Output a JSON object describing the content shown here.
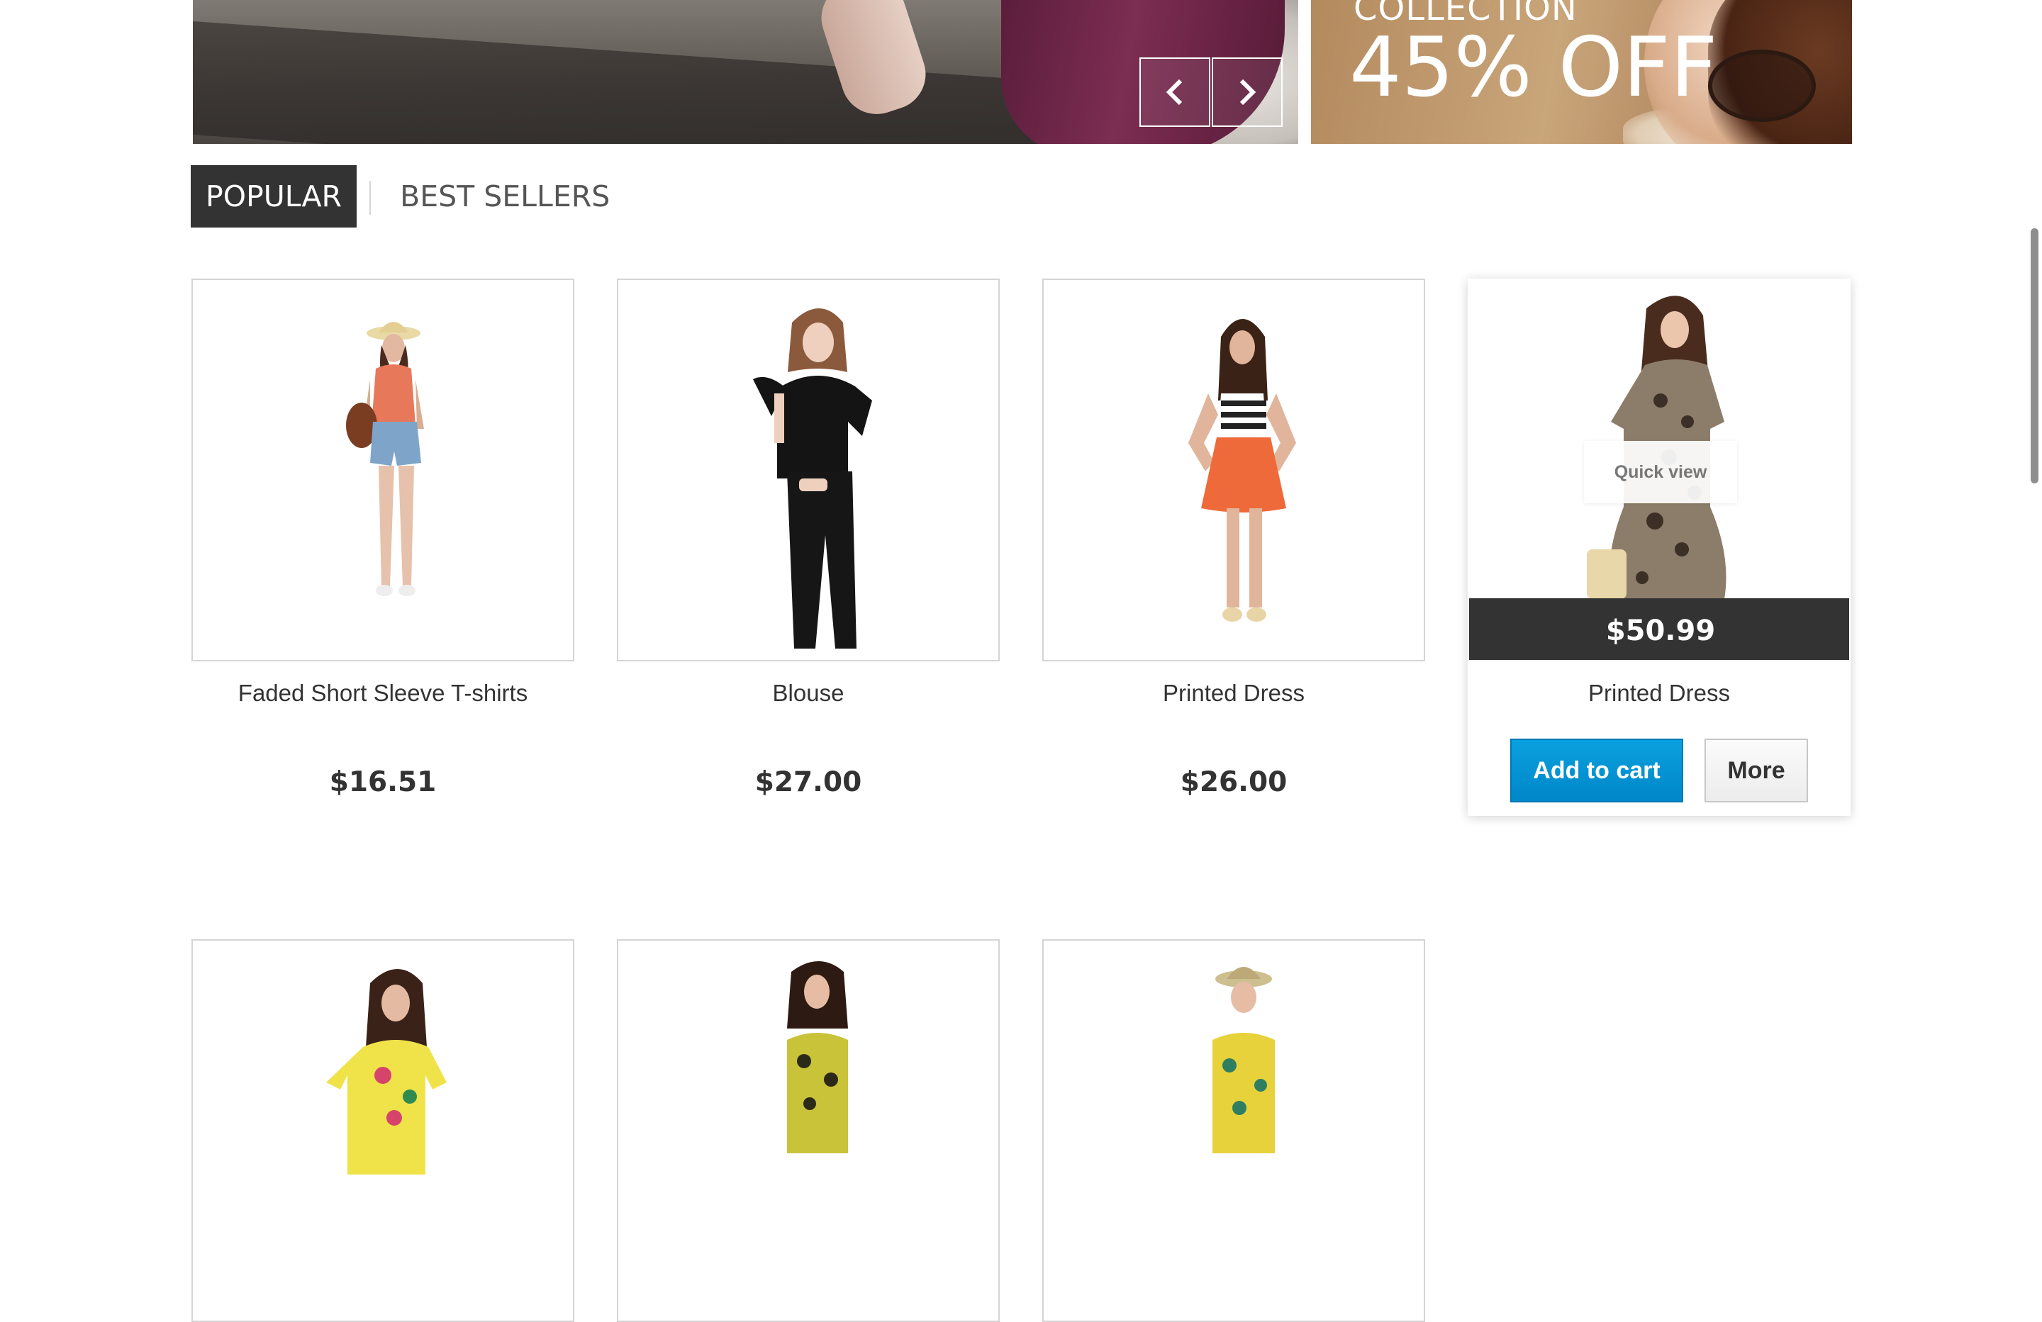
{
  "banners": {
    "side_banner": {
      "collection_text": "COLLECTION",
      "discount_text": "45% OFF"
    }
  },
  "slider": {
    "prev_icon": "chevron-left-icon",
    "next_icon": "chevron-right-icon"
  },
  "tabs": [
    {
      "label": "Popular",
      "active": true
    },
    {
      "label": "Best Sellers",
      "active": false
    }
  ],
  "products": [
    {
      "name": "Faded Short Sleeve T-shirts",
      "price": "$16.51"
    },
    {
      "name": "Blouse",
      "price": "$27.00"
    },
    {
      "name": "Printed Dress",
      "price": "$26.00"
    },
    {
      "name": "Printed Dress",
      "price": "$50.99",
      "hovered": true,
      "quick_view_label": "Quick view",
      "add_to_cart_label": "Add to cart",
      "more_label": "More"
    }
  ],
  "colors": {
    "tab_active_bg": "#333333",
    "add_to_cart_bg": "#0095d6",
    "price_strip_bg": "#333333"
  }
}
